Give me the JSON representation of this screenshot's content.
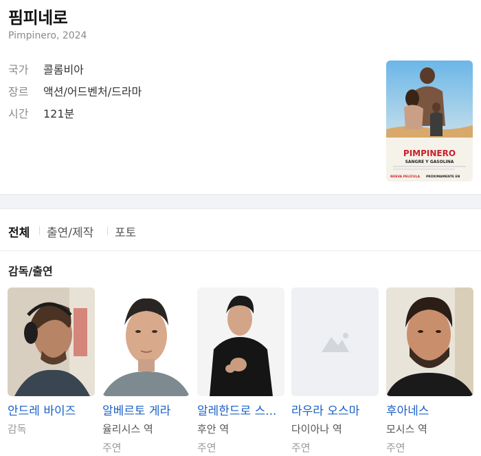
{
  "movie": {
    "title": "핌피네로",
    "subtitle": "Pimpinero, 2024",
    "info": [
      {
        "key": "국가",
        "value": "콜롬비아"
      },
      {
        "key": "장르",
        "value": "액션/어드벤처/드라마"
      },
      {
        "key": "시간",
        "value": "121분"
      }
    ],
    "poster": {
      "headline": "PIMPINERO",
      "tagline": "SANGRE Y GASOLINA",
      "footer_left": "NUEVA PELÍCULA",
      "footer_right": "PRÓXIMAMENTE EN"
    }
  },
  "tabs": [
    {
      "label": "전체",
      "active": true
    },
    {
      "label": "출연/제작",
      "active": false
    },
    {
      "label": "포토",
      "active": false
    }
  ],
  "section_title": "감독/출연",
  "cast": [
    {
      "name": "안드레 바이즈",
      "role": "감독",
      "sub": ""
    },
    {
      "name": "알베르토 게라",
      "role": "율리시스 역",
      "sub": "주연"
    },
    {
      "name": "알레한드로 스...",
      "role": "후안 역",
      "sub": "주연"
    },
    {
      "name": "라우라 오스마",
      "role": "다이아나 역",
      "sub": "주연"
    },
    {
      "name": "후아네스",
      "role": "모시스 역",
      "sub": "주연"
    }
  ],
  "colors": {
    "link": "#1a5fc7",
    "muted": "#8a8a8a",
    "divider": "#f1f3f6"
  },
  "icons": {
    "placeholder": "image-placeholder-icon"
  }
}
